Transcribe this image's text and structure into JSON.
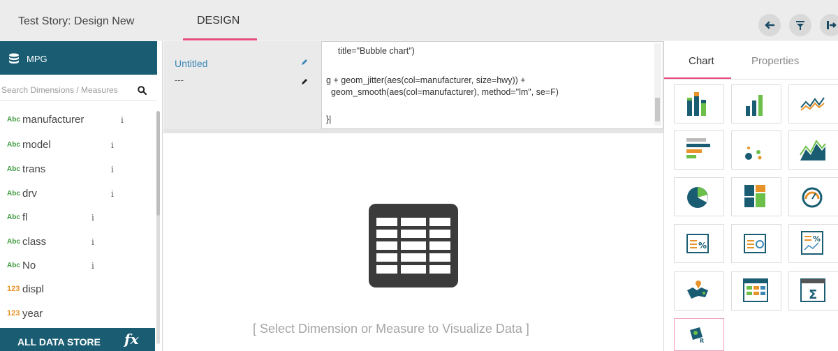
{
  "header": {
    "story_title": "Test Story: Design New",
    "active_tab": "DESIGN",
    "buttons": [
      {
        "name": "back-arrow-icon"
      },
      {
        "name": "filter-icon"
      },
      {
        "name": "exit-icon"
      }
    ]
  },
  "sidebar": {
    "dataset_icon": "database-icon",
    "dataset_name": "MPG",
    "search_placeholder": "Search Dimensions / Measures",
    "fields": [
      {
        "type": "Abc",
        "name": "manufacturer",
        "info": "i"
      },
      {
        "type": "Abc",
        "name": "model",
        "info": "i"
      },
      {
        "type": "Abc",
        "name": "trans",
        "info": "i"
      },
      {
        "type": "Abc",
        "name": "drv",
        "info": "i"
      },
      {
        "type": "Abc",
        "name": "fl",
        "info": "i"
      },
      {
        "type": "Abc",
        "name": "class",
        "info": "i"
      },
      {
        "type": "Abc",
        "name": "No",
        "info": "i"
      },
      {
        "type": "123",
        "name": "displ",
        "info": ""
      },
      {
        "type": "123",
        "name": "year",
        "info": ""
      }
    ],
    "footer_label": "ALL DATA STORE",
    "footer_fx": "fx"
  },
  "script": {
    "name": "Untitled",
    "subtitle": "---",
    "code_lines": [
      "      title=\"Bubble chart\")",
      "",
      "g + geom_jitter(aes(col=manufacturer, size=hwy)) +",
      "  geom_smooth(aes(col=manufacturer), method=\"lm\", se=F)",
      "",
      "}|"
    ]
  },
  "canvas": {
    "icon": "table-icon",
    "hint": "[ Select Dimension or Measure to Visualize Data ]"
  },
  "right_panel": {
    "tabs": [
      "Chart",
      "Properties"
    ],
    "active_tab": "Chart",
    "chart_types": [
      "column-chart-icon",
      "bar-chart-icon",
      "line-chart-icon",
      "horizontal-bar-chart-icon",
      "scatter-chart-icon",
      "area-chart-icon",
      "pie-chart-icon",
      "treemap-chart-icon",
      "gauge-chart-icon",
      "kpi-percent-icon",
      "kpi-target-icon",
      "kpi-trend-icon",
      "map-chart-icon",
      "data-grid-icon",
      "pivot-grid-icon",
      "r-script-chart-icon"
    ]
  },
  "colors": {
    "primary": "#1a5d73",
    "accent": "#e84a7b",
    "link": "#3b87b5",
    "dimension_type": "#3f9a3f",
    "measure_type": "#e8922a"
  }
}
